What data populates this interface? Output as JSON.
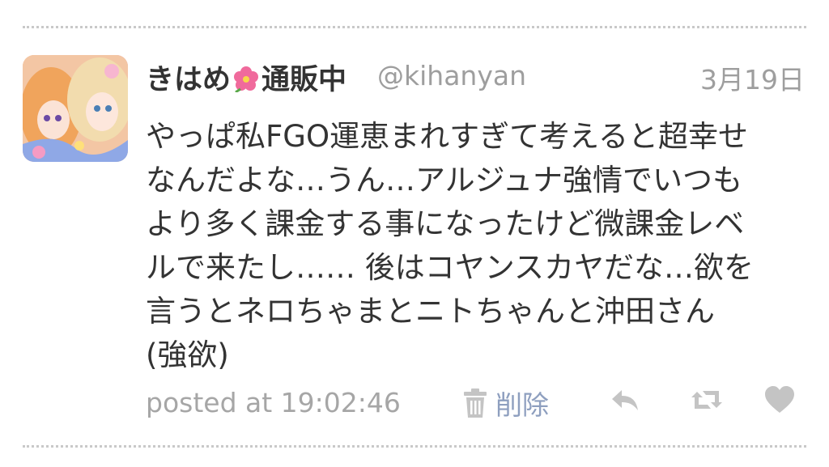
{
  "tweet": {
    "author_name_part1": "きはめ",
    "author_name_part2": "通販中",
    "handle": "@kihanyan",
    "date": "3月19日",
    "lines": [
      "やっぱ私FGO運恵まれすぎて考えると超幸せ",
      "なんだよな…うん…アルジュナ強情でいつも",
      "より多く課金する事になったけど微課金レベ",
      "ルで来たし…… 後はコヤンスカヤだな…欲を",
      "言うとネロちゃまとニトちゃんと沖田さん",
      "(強欲)"
    ],
    "posted_at": "posted at 19:02:46",
    "delete_label": "削除"
  },
  "icons": {
    "avatar": "avatar-image",
    "flower": "hibiscus-emoji",
    "trash": "trash-icon",
    "reply": "reply-icon",
    "retweet": "retweet-icon",
    "favorite": "heart-icon"
  },
  "colors": {
    "text": "#333333",
    "muted": "#9e9e9e",
    "link": "#8e9fbf",
    "icon": "#c4c4c4",
    "divider": "#c9c9c9"
  }
}
